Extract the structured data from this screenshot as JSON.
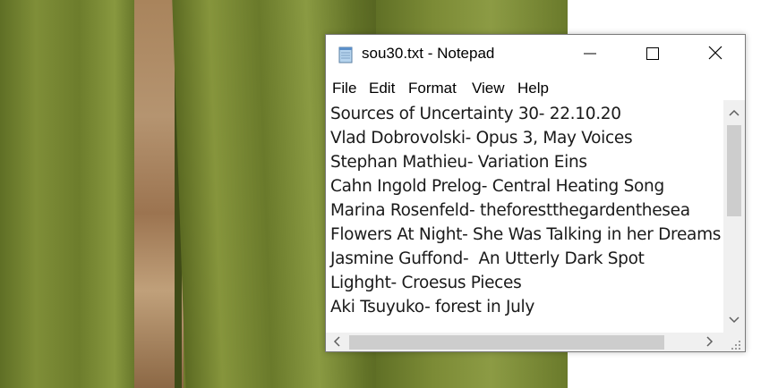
{
  "window": {
    "title": "sou30.txt - Notepad",
    "controls": {
      "minimize": "minimize-icon",
      "maximize": "maximize-icon",
      "close": "close-icon"
    }
  },
  "menu": [
    "File",
    "Edit",
    "Format",
    "View",
    "Help"
  ],
  "editor": {
    "lines": [
      "Sources of Uncertainty 30- 22.10.20",
      "Vlad Dobrovolski- Opus 3, May Voices",
      "Stephan Mathieu- Variation Eins",
      "Cahn Ingold Prelog- Central Heating Song",
      "Marina Rosenfeld- theforestthegardenthesea",
      "Flowers At Night- She Was Talking in her Dreams",
      "Jasmine Guffond-  An Utterly Dark Spot",
      "Lighght- Croesus Pieces",
      "Aki Tsuyuko- forest in July"
    ]
  },
  "scrollbars": {
    "up": "chevron-up-icon",
    "down": "chevron-down-icon",
    "left": "chevron-left-icon",
    "right": "chevron-right-icon",
    "grip": "resize-grip-icon"
  }
}
